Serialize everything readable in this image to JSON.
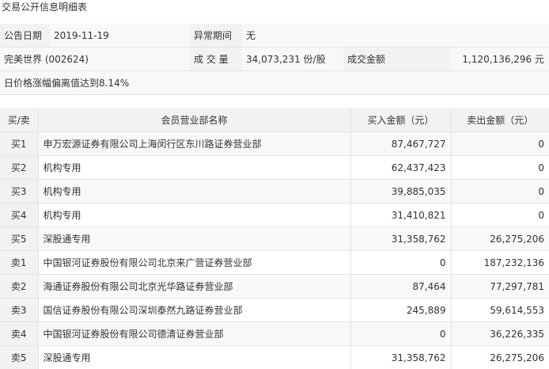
{
  "title": "交易公开信息明细表",
  "info": {
    "announce_date_label": "公告日期",
    "announce_date": "2019-11-19",
    "anomaly_period_label": "异常期间",
    "anomaly_period": "无",
    "stock": "完美世界 (002624)",
    "volume_label": "成 交 量",
    "volume": "34,073,231 份/股",
    "amount_label": "成交金额",
    "amount": "1,120,136,296 元",
    "reason": "日价格涨幅偏离值达到8.14%"
  },
  "table": {
    "headers": [
      "买/卖",
      "会员营业部名称",
      "买入金额（元）",
      "卖出金额（元）"
    ],
    "rows": [
      {
        "side": "买1",
        "name": "申万宏源证券有限公司上海闵行区东川路证券营业部",
        "buy": "87,467,727",
        "sell": "0"
      },
      {
        "side": "买2",
        "name": "机构专用",
        "buy": "62,437,423",
        "sell": "0"
      },
      {
        "side": "买3",
        "name": "机构专用",
        "buy": "39,885,035",
        "sell": "0"
      },
      {
        "side": "买4",
        "name": "机构专用",
        "buy": "31,410,821",
        "sell": "0"
      },
      {
        "side": "买5",
        "name": "深股通专用",
        "buy": "31,358,762",
        "sell": "26,275,206"
      },
      {
        "side": "卖1",
        "name": "中国银河证券股份有限公司北京来广营证券营业部",
        "buy": "0",
        "sell": "187,232,136"
      },
      {
        "side": "卖2",
        "name": "海通证券股份有限公司北京光华路证券营业部",
        "buy": "87,464",
        "sell": "77,297,781"
      },
      {
        "side": "卖3",
        "name": "国信证券股份有限公司深圳泰然九路证券营业部",
        "buy": "245,889",
        "sell": "59,614,553"
      },
      {
        "side": "卖4",
        "name": "中国银河证券股份有限公司德清证券营业部",
        "buy": "0",
        "sell": "36,226,335"
      },
      {
        "side": "卖5",
        "name": "深股通专用",
        "buy": "31,358,762",
        "sell": "26,275,206"
      }
    ]
  }
}
